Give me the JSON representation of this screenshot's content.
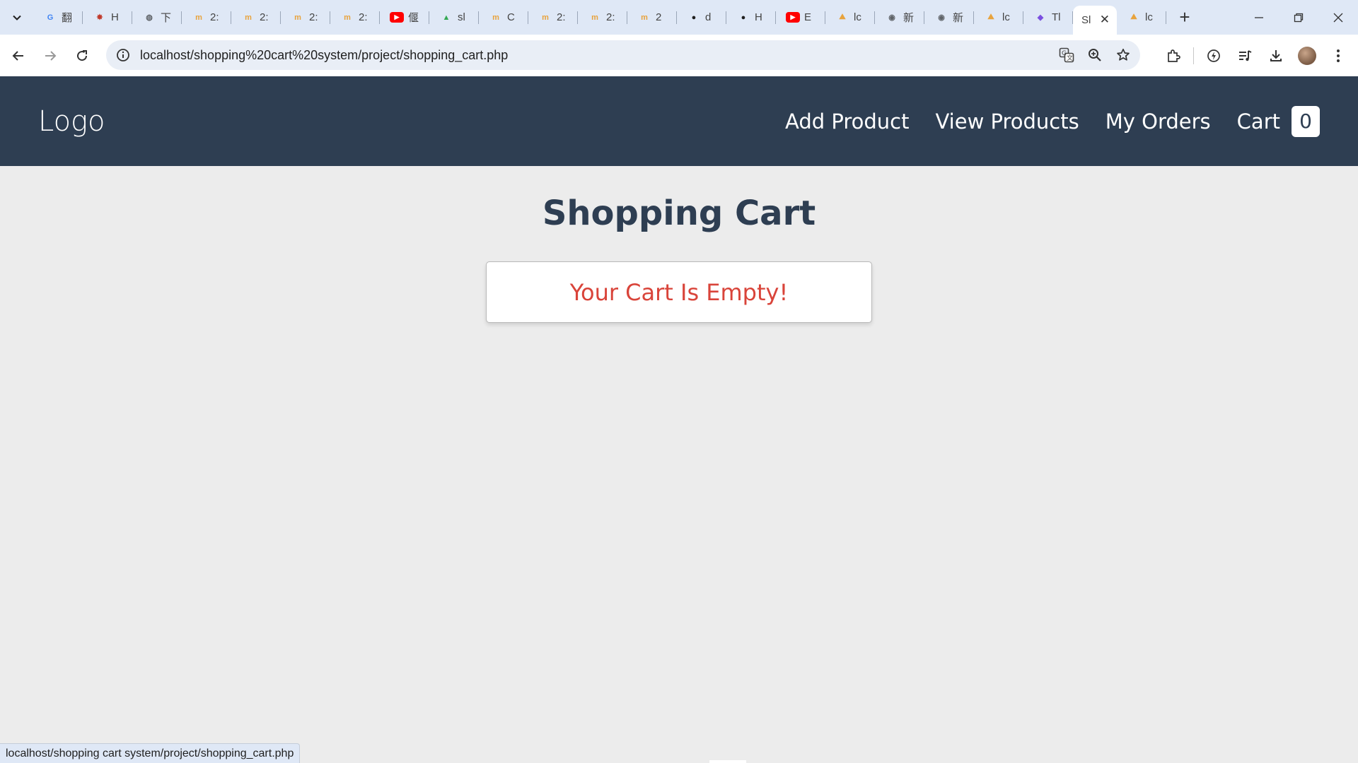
{
  "browser": {
    "tabs": [
      {
        "icon": "google-icon",
        "title": "翻",
        "color": "#4285f4"
      },
      {
        "icon": "bug-icon",
        "title": "H",
        "color": "#c0392b"
      },
      {
        "icon": "globe-icon",
        "title": "下",
        "color": "#5f6368"
      },
      {
        "icon": "m-icon",
        "title": "2:",
        "color": "#e8a33d"
      },
      {
        "icon": "m-icon",
        "title": "2:",
        "color": "#e8a33d"
      },
      {
        "icon": "m-icon",
        "title": "2:",
        "color": "#e8a33d"
      },
      {
        "icon": "m-icon",
        "title": "2:",
        "color": "#e8a33d"
      },
      {
        "icon": "youtube-icon",
        "title": "偃",
        "color": "#ff0000"
      },
      {
        "icon": "drive-icon",
        "title": "sl",
        "color": "#34a853"
      },
      {
        "icon": "m-icon",
        "title": "C",
        "color": "#e8a33d"
      },
      {
        "icon": "m-icon",
        "title": "2:",
        "color": "#e8a33d"
      },
      {
        "icon": "m-icon",
        "title": "2:",
        "color": "#e8a33d"
      },
      {
        "icon": "m-icon",
        "title": "2",
        "color": "#e8a33d"
      },
      {
        "icon": "github-icon",
        "title": "d",
        "color": "#1f1f1f"
      },
      {
        "icon": "github-icon",
        "title": "H",
        "color": "#1f1f1f"
      },
      {
        "icon": "youtube-icon",
        "title": "E",
        "color": "#ff0000"
      },
      {
        "icon": "pma-icon",
        "title": "lc",
        "color": "#e8a33d"
      },
      {
        "icon": "chrome-icon",
        "title": "新",
        "color": "#5f6368"
      },
      {
        "icon": "chrome-icon",
        "title": "新",
        "color": "#5f6368"
      },
      {
        "icon": "pma-icon",
        "title": "lc",
        "color": "#e8a33d"
      },
      {
        "icon": "tailwind-icon",
        "title": "Tl",
        "color": "#7b4fe0"
      }
    ],
    "active_tab": {
      "title": "Sl",
      "close": "✕"
    },
    "trailing_tab": {
      "icon": "pma-icon",
      "title": "lc",
      "color": "#e8a33d"
    },
    "new_tab": "+",
    "url": "localhost/shopping%20cart%20system/project/shopping_cart.php",
    "status_url": "localhost/shopping cart system/project/shopping_cart.php"
  },
  "site": {
    "logo": "Logo",
    "nav": {
      "add_product": "Add Product",
      "view_products": "View Products",
      "my_orders": "My Orders",
      "cart": "Cart",
      "cart_count": "0"
    },
    "page_title": "Shopping Cart",
    "empty_message": "Your Cart Is Empty!",
    "colors": {
      "header_bg": "#2e3e52",
      "empty_text": "#d9443a",
      "page_bg": "#ececec"
    }
  }
}
